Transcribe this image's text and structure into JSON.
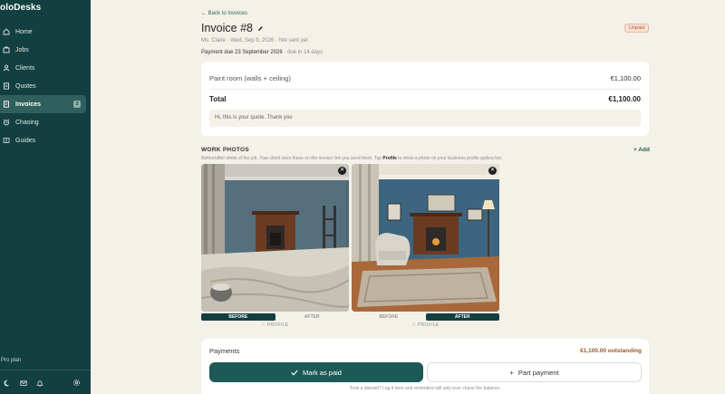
{
  "app": {
    "brand": "oloDesks"
  },
  "sidebar": {
    "items": [
      {
        "label": "Home",
        "icon": "home-icon"
      },
      {
        "label": "Jobs",
        "icon": "briefcase-icon"
      },
      {
        "label": "Clients",
        "icon": "person-icon"
      },
      {
        "label": "Quotes",
        "icon": "document-icon"
      },
      {
        "label": "Invoices",
        "icon": "invoice-icon",
        "active": true,
        "badge": "3"
      },
      {
        "label": "Chasing",
        "icon": "alarm-icon"
      },
      {
        "label": "Guides",
        "icon": "book-icon"
      }
    ],
    "plan": "Pro plan",
    "bottom_icons": [
      "moon-icon",
      "mail-icon",
      "bell-icon",
      "gear-icon"
    ]
  },
  "invoice": {
    "back_link": "← Back to invoices",
    "title": "Invoice #8",
    "status": "Unpaid",
    "meta": "Ms. Claire · Wed, Sep 9, 2026 · Not sent yet",
    "due_prefix": "Payment due 23 September 2026",
    "due_suffix": " · due in 14 days",
    "line_item": {
      "label": "Paint room (walls + ceiling)",
      "amount": "€1,100.00"
    },
    "total": {
      "label": "Total",
      "amount": "€1,100.00"
    },
    "note": "Hi, this is your quote. Thank you"
  },
  "photos": {
    "title": "WORK PHOTOS",
    "add_label": "+ Add",
    "subtitle_a": "Before/after shots of the job. Your client sees these on the invoice link you send them. Tap ",
    "subtitle_b": "Profile",
    "subtitle_c": " to show a photo on your business profile gallery too.",
    "items": [
      {
        "before_label": "BEFORE",
        "after_label": "AFTER",
        "selected": "before",
        "profile_label": "☆ PROFILE"
      },
      {
        "before_label": "BEFORE",
        "after_label": "AFTER",
        "selected": "after",
        "profile_label": "☆ PROFILE"
      }
    ]
  },
  "payments": {
    "title": "Payments",
    "outstanding": "€1,100.00 outstanding",
    "mark_paid": "Mark as paid",
    "part_payment": "Part payment",
    "hint": "Took a deposit? Log it here and reminders will only ever chase the balance."
  },
  "colors": {
    "sidebar_bg": "#123f3f",
    "accent": "#1d5a57",
    "page_bg": "#f4f1e8",
    "unpaid": "#b05a3a"
  }
}
